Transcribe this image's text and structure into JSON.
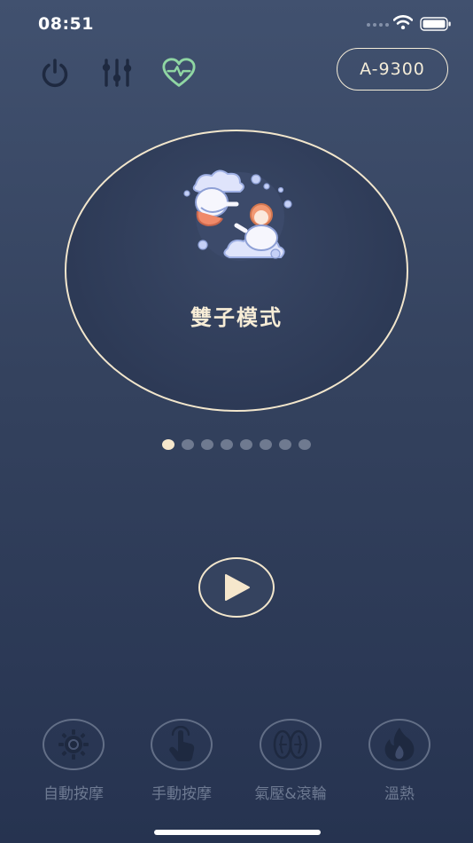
{
  "status_bar": {
    "time": "08:51"
  },
  "toolbar": {
    "power_icon": "power-icon",
    "settings_icon": "sliders-icon",
    "health_icon": "heart-pulse-icon",
    "device_id": "A-9300"
  },
  "mode": {
    "name": "雙子模式",
    "illustration": "gemini-twins-illustration",
    "page_index": 1,
    "page_count": 8
  },
  "play_icon": "play-icon",
  "bottom_nav": [
    {
      "label": "自動按摩",
      "icon": "auto-massage-icon"
    },
    {
      "label": "手動按摩",
      "icon": "hand-touch-icon"
    },
    {
      "label": "氣壓&滾輪",
      "icon": "airbag-roller-icon"
    },
    {
      "label": "溫熱",
      "icon": "flame-icon"
    }
  ],
  "colors": {
    "accent_cream": "#f2e6cc",
    "health_green": "#8fd6a3",
    "inactive_icon": "#1e2940",
    "nav_inactive": "#636f87",
    "background_top": "#41516f",
    "background_bottom": "#263350"
  }
}
